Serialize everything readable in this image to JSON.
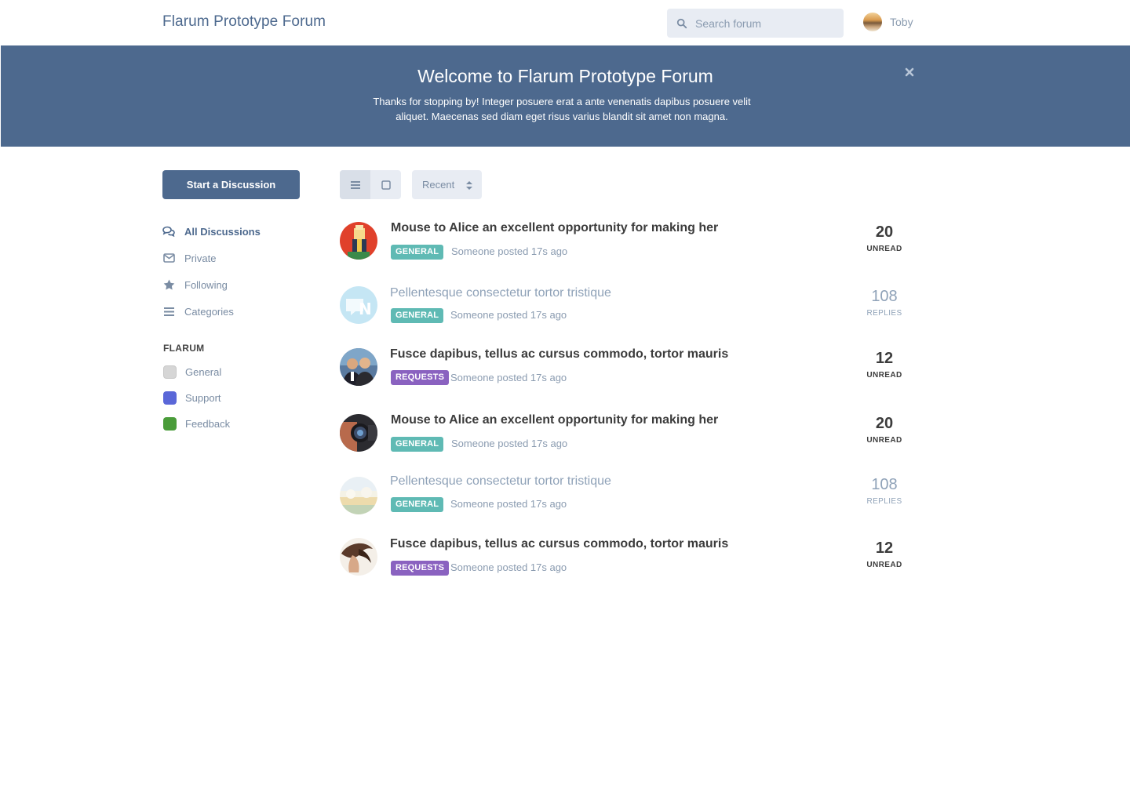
{
  "header": {
    "brand": "Flarum Prototype Forum",
    "search_placeholder": "Search forum",
    "user_name": "Toby"
  },
  "hero": {
    "title": "Welcome to Flarum Prototype Forum",
    "text": "Thanks for stopping by! Integer posuere erat a ante venenatis dapibus posuere velit aliquet. Maecenas sed diam eget risus varius blandit sit amet non magna."
  },
  "sidebar": {
    "start_button": "Start a Discussion",
    "nav": [
      {
        "label": "All Discussions",
        "icon": "comments-icon",
        "active": true
      },
      {
        "label": "Private",
        "icon": "envelope-icon"
      },
      {
        "label": "Following",
        "icon": "star-icon"
      },
      {
        "label": "Categories",
        "icon": "list-icon"
      }
    ],
    "section_title": "FLARUM",
    "categories": [
      {
        "label": "General",
        "color": "#d6d6d6"
      },
      {
        "label": "Support",
        "color": "#5a67d8"
      },
      {
        "label": "Feedback",
        "color": "#4a9c3a"
      }
    ]
  },
  "toolbar": {
    "sort_label": "Recent"
  },
  "discussions": [
    {
      "title": "Mouse to Alice an excellent opportunity for making her",
      "tag": "GENERAL",
      "meta": "Someone posted 17s ago",
      "count": "20",
      "count_label": "UNREAD",
      "read": false
    },
    {
      "title": "Pellentesque consectetur tortor tristique",
      "tag": "GENERAL",
      "meta": "Someone posted 17s ago",
      "count": "108",
      "count_label": "REPLIES",
      "read": true
    },
    {
      "title": "Fusce dapibus, tellus ac cursus commodo, tortor mauris",
      "tag": "REQUESTS",
      "meta": "Someone posted 17s ago",
      "count": "12",
      "count_label": "UNREAD",
      "read": false
    },
    {
      "title": "Mouse to Alice an excellent opportunity for making her",
      "tag": "GENERAL",
      "meta": "Someone posted 17s ago",
      "count": "20",
      "count_label": "UNREAD",
      "read": false
    },
    {
      "title": "Pellentesque consectetur tortor tristique",
      "tag": "GENERAL",
      "meta": "Someone posted 17s ago",
      "count": "108",
      "count_label": "REPLIES",
      "read": true
    },
    {
      "title": "Fusce dapibus, tellus ac cursus commodo, tortor mauris",
      "tag": "REQUESTS",
      "meta": "Someone posted 17s ago",
      "count": "12",
      "count_label": "UNREAD",
      "read": false
    }
  ],
  "colors": {
    "primary": "#4d698e",
    "tag_general": "#5fbab4",
    "tag_requests": "#8a62c0"
  }
}
